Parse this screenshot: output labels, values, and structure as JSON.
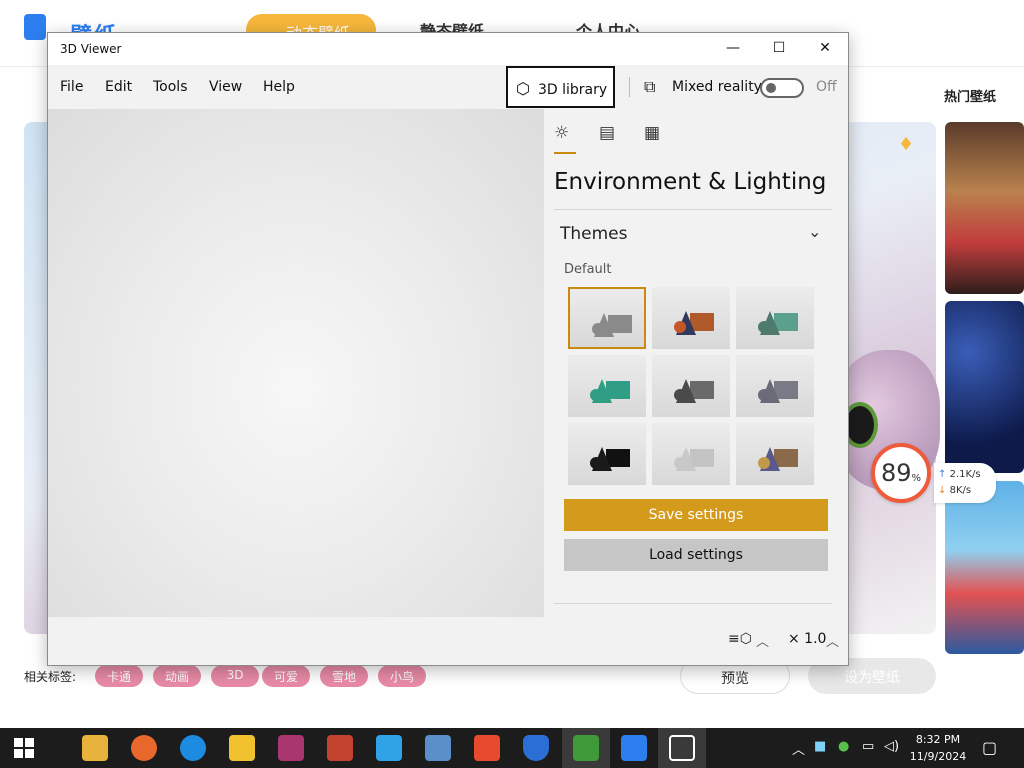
{
  "background_app": {
    "brand": "壁纸",
    "tabs": [
      "动态壁纸",
      "静态壁纸",
      "个人中心"
    ],
    "hot_title": "热门壁纸",
    "progress_value": "89",
    "progress_unit": "%",
    "upload_speed": "2.1K/s",
    "download_speed": "8K/s",
    "related_tags_label": "相关标签:",
    "tags": [
      "卡通",
      "动画",
      "3D",
      "可爱",
      "雪地",
      "小鸟"
    ],
    "preview_button": "预览",
    "set_wallpaper_button": "设为壁纸"
  },
  "window": {
    "title": "3D Viewer",
    "minimize": "—",
    "maximize": "☐",
    "close": "✕"
  },
  "menu": {
    "file": "File",
    "edit": "Edit",
    "tools": "Tools",
    "view": "View",
    "help": "Help",
    "library": "3D library",
    "mixed_reality": "Mixed reality",
    "toggle_state": "Off"
  },
  "panel": {
    "title": "Environment & Lighting",
    "section": "Themes",
    "default_label": "Default",
    "themes": [
      {
        "name": "theme-1",
        "cone": "#8a8a8a",
        "box": "#8a8a8a",
        "ball": "#8a8a8a",
        "selected": true
      },
      {
        "name": "theme-2",
        "cone": "#2f3a5e",
        "box": "#b05a2a",
        "ball": "#c4562a",
        "selected": false
      },
      {
        "name": "theme-3",
        "cone": "#4f7a6e",
        "box": "#5aa08a",
        "ball": "#4f7a6e",
        "selected": false
      },
      {
        "name": "theme-4",
        "cone": "#2f9e84",
        "box": "#2f9e84",
        "ball": "#2f9e84",
        "selected": false
      },
      {
        "name": "theme-5",
        "cone": "#4a4a4a",
        "box": "#6a6a6a",
        "ball": "#4a4a4a",
        "selected": false
      },
      {
        "name": "theme-6",
        "cone": "#6a6a78",
        "box": "#7a7a86",
        "ball": "#6a6a78",
        "selected": false
      },
      {
        "name": "theme-7",
        "cone": "#1a1a1a",
        "box": "#111111",
        "ball": "#1a1a1a",
        "selected": false
      },
      {
        "name": "theme-8",
        "cone": "#c8c8c8",
        "box": "#c4c4c4",
        "ball": "#c8c8c8",
        "selected": false
      },
      {
        "name": "theme-9",
        "cone": "#5a5a8a",
        "box": "#8a6a4a",
        "ball": "#c09a4a",
        "selected": false
      }
    ],
    "save_button": "Save settings",
    "load_button": "Load settings"
  },
  "status": {
    "speed": "× 1.0"
  },
  "taskbar": {
    "time": "8:32 PM",
    "date": "11/9/2024"
  },
  "colors": {
    "accent": "#d49a1c",
    "tag_pink": "#e88aa5"
  }
}
